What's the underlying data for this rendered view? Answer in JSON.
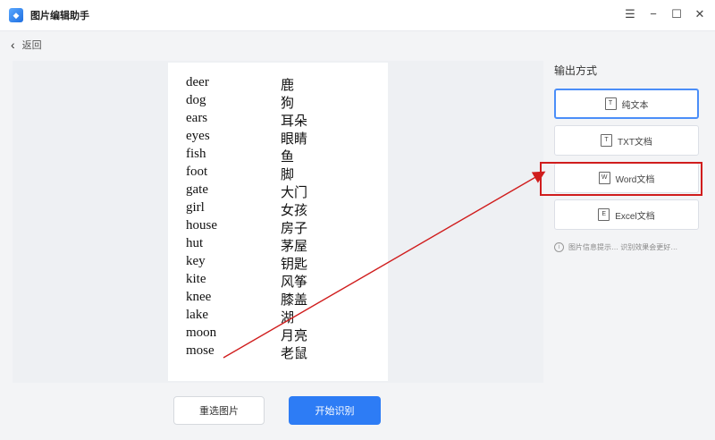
{
  "app": {
    "title": "图片编辑助手"
  },
  "window_controls": {
    "menu": "☰",
    "minimize": "−",
    "maximize": "☐",
    "close": "✕"
  },
  "nav": {
    "back_label": "返回"
  },
  "words": [
    {
      "en": "deer",
      "zh": "鹿"
    },
    {
      "en": "dog",
      "zh": "狗"
    },
    {
      "en": "ears",
      "zh": "耳朵"
    },
    {
      "en": "eyes",
      "zh": "眼睛"
    },
    {
      "en": "fish",
      "zh": "鱼"
    },
    {
      "en": "foot",
      "zh": "脚"
    },
    {
      "en": "gate",
      "zh": "大门"
    },
    {
      "en": "girl",
      "zh": "女孩"
    },
    {
      "en": "house",
      "zh": "房子"
    },
    {
      "en": "hut",
      "zh": "茅屋"
    },
    {
      "en": "key",
      "zh": "钥匙"
    },
    {
      "en": "kite",
      "zh": "风筝"
    },
    {
      "en": "knee",
      "zh": "膝盖"
    },
    {
      "en": "lake",
      "zh": "湖"
    },
    {
      "en": "moon",
      "zh": "月亮"
    },
    {
      "en": "mose",
      "zh": "老鼠"
    }
  ],
  "output": {
    "title": "输出方式",
    "options": [
      {
        "label": "纯文本",
        "icon": "T"
      },
      {
        "label": "TXT文档",
        "icon": "T"
      },
      {
        "label": "Word文档",
        "icon": "W"
      },
      {
        "label": "Excel文档",
        "icon": "E"
      }
    ],
    "hint": "图片信息提示…  识别效果会更好…"
  },
  "actions": {
    "reselect": "重选图片",
    "start": "开始识别"
  },
  "colors": {
    "accent": "#2d7cf5",
    "annotation": "#d01d1d"
  }
}
